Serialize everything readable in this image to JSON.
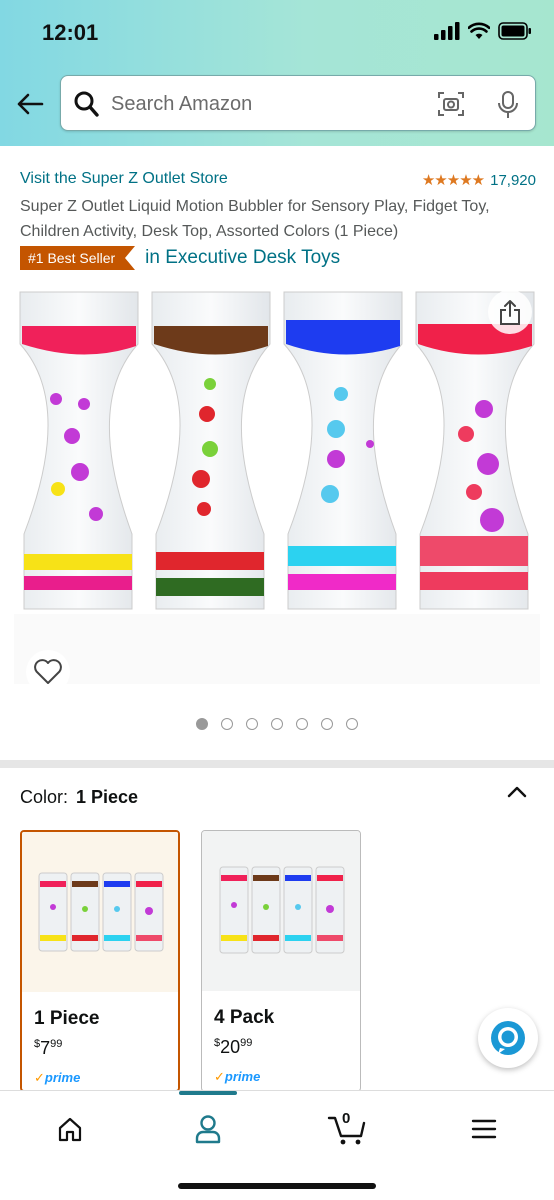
{
  "status_bar": {
    "time": "12:01",
    "icons": [
      "signal-icon",
      "wifi-icon",
      "battery-icon"
    ]
  },
  "header": {
    "back_icon": "back-arrow-icon",
    "search_placeholder": "Search Amazon",
    "camera_icon": "camera-icon",
    "mic_icon": "mic-icon"
  },
  "product": {
    "store_link": "Visit the Super Z Outlet Store",
    "stars": "★★★★★",
    "rating_value": 4.5,
    "rating_count": "17,920",
    "title": "Super Z Outlet Liquid Motion Bubbler for Sensory Play, Fidget Toy, Children Activity, Desk Top, Assorted Colors (1 Piece)",
    "best_seller_badge": "#1 Best Seller",
    "best_seller_category": "in Executive Desk Toys",
    "image_count": 7,
    "active_image_index": 0
  },
  "variations": {
    "label": "Color:",
    "selected": "1 Piece",
    "options": [
      {
        "name": "1 Piece",
        "currency": "$",
        "whole": "7",
        "fraction": "99",
        "prime": "prime",
        "selected": true
      },
      {
        "name": "4 Pack",
        "currency": "$",
        "whole": "20",
        "fraction": "99",
        "prime": "prime",
        "selected": false
      }
    ]
  },
  "colors": {
    "link": "#007185",
    "badge": "#c45500",
    "star": "#de7921",
    "prime": "#1a98ff",
    "nav_active": "#1f7a8c"
  },
  "bottom_nav": {
    "cart_count": "0",
    "active": "account"
  }
}
